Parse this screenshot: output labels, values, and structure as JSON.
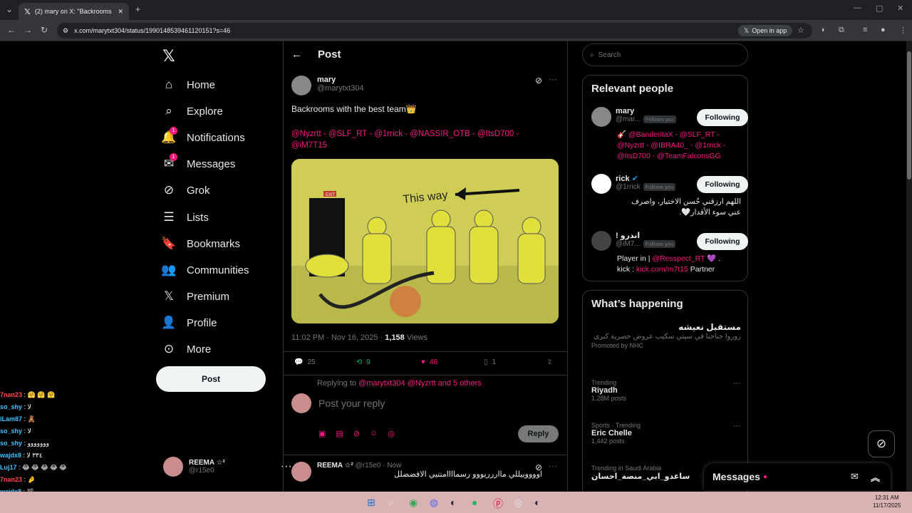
{
  "browser": {
    "tab_title": "(2) mary on X: \"Backrooms with",
    "url": "x.com/marytxt304/status/1990148539461120151?s=46",
    "open_in_app": "Open in app"
  },
  "nav": {
    "items": [
      {
        "label": "Home",
        "icon": "home-icon"
      },
      {
        "label": "Explore",
        "icon": "search-icon"
      },
      {
        "label": "Notifications",
        "icon": "bell-icon",
        "badge": "1"
      },
      {
        "label": "Messages",
        "icon": "envelope-icon",
        "badge": "1"
      },
      {
        "label": "Grok",
        "icon": "grok-icon"
      },
      {
        "label": "Lists",
        "icon": "list-icon"
      },
      {
        "label": "Bookmarks",
        "icon": "bookmark-icon"
      },
      {
        "label": "Communities",
        "icon": "people-icon"
      },
      {
        "label": "Premium",
        "icon": "x-logo-icon"
      },
      {
        "label": "Profile",
        "icon": "person-icon"
      },
      {
        "label": "More",
        "icon": "more-circle-icon"
      }
    ],
    "post_button": "Post",
    "account": {
      "name": "REEMA ☆²",
      "handle": "@r15e0"
    }
  },
  "chat": [
    {
      "user": "7nan23",
      "msg": ": 🤗 🤗 🤗",
      "color": "r"
    },
    {
      "user": "so_shy",
      "msg": ": لا"
    },
    {
      "user": "iLam87",
      "msg": ": 🧸"
    },
    {
      "user": "so_shy",
      "msg": ": لا"
    },
    {
      "user": "so_shy",
      "msg": ": ووووووو"
    },
    {
      "user": "wajdx8",
      "msg": ": ٣٣٤ لا"
    },
    {
      "user": "Luj17",
      "msg": ": 😂 😂 😂 😂 😂"
    },
    {
      "user": "7nan23",
      "msg": ": 🤌",
      "color": "r"
    },
    {
      "user": "wajdx8",
      "msg": ": 🏴"
    }
  ],
  "main": {
    "header": "Post",
    "author": {
      "name": "mary",
      "handle": "@marytxt304"
    },
    "text": "Backrooms with the best team👑",
    "mentions": "@Nyzrtt - @SLF_RT - @1rrick - @NASSIR_OTB - @ItsD700 - @iM7T15",
    "image_label": "This way",
    "exit_sign": "EXIT",
    "timestamp": "11:02 PM · Nov 16, 2025 · ",
    "views_count": "1,158",
    "views_label": " Views",
    "stats": {
      "replies": "25",
      "reposts": "9",
      "likes": "46",
      "bookmarks": "1"
    },
    "replying_prefix": "Replying to ",
    "replying_to": "@marytxt304 @Nyzrtt and 5 others",
    "reply_placeholder": "Post your reply",
    "reply_button": "Reply",
    "reply": {
      "name": "REEMA ☆²",
      "handle": "@r15e0",
      "time": "· Now",
      "text": "اووووييللي مااررريووو رسماااامتتيي الافضضلل"
    }
  },
  "sidebar": {
    "search_placeholder": "Search",
    "relevant_title": "Relevant people",
    "people": [
      {
        "name": "mary",
        "handle": "@mar...",
        "follows_you": "Follows you",
        "button": "Following",
        "bio_prefix": "🎸 ",
        "bio": "@BanderitaX - @SLF_RT - @Nyzrtt - @IBRA40_ - @1rrick - @ItsD700 - @TeamFalconsGG"
      },
      {
        "name": "rick",
        "handle": "@1rrick",
        "follows_you": "Follows you",
        "button": "Following",
        "bio": "اللهم ارزقني حُسن الاختيار، واصرف عني سوء الأقدار🤍."
      },
      {
        "name": "! اندرو",
        "handle": "@iM7...",
        "follows_you": "Follows you",
        "button": "Following",
        "bio_pre": "Player in | ",
        "bio_link": "@Resspect_RT",
        "bio_mid": " 💜 .",
        "bio_line2": "kick : ",
        "bio_link2": "kick.com/m7t15",
        "bio_end": " Partner"
      }
    ],
    "happening_title": "What’s happening",
    "promo": {
      "title": "مستقبل نعيشه",
      "text": "زوروا جناحنا في سيتي سكيب عروض حصرية كبرى",
      "promoted": "Promoted by NHC"
    },
    "trends": [
      {
        "section": "Trending",
        "title": "Riyadh",
        "count": "1.28M posts"
      },
      {
        "section": "Sports · Trending",
        "title": "Eric Chelle",
        "count": "1,442 posts"
      },
      {
        "section": "Trending in Saudi Arabia",
        "title": "ساعدو_ابي_منصة_احسان",
        "count": ""
      }
    ],
    "messages_label": "Messages"
  },
  "taskbar": {
    "time": "12:31 AM",
    "date": "11/17/2025"
  }
}
